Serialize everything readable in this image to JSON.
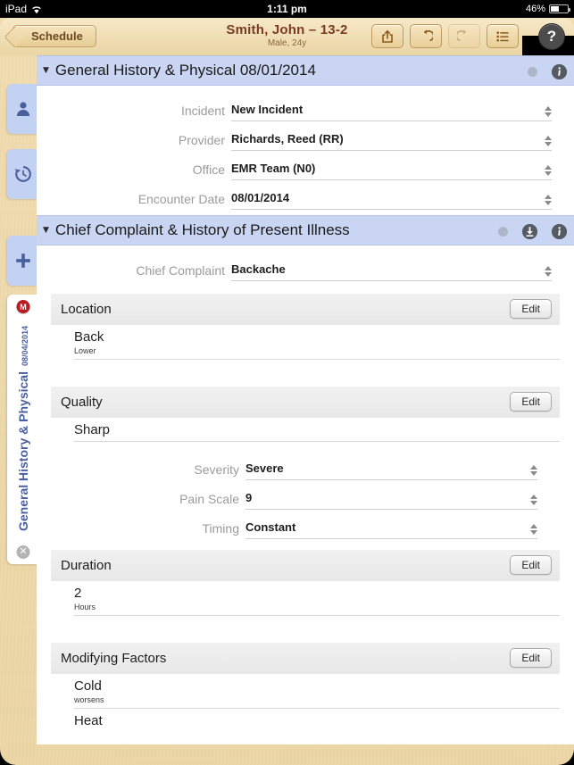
{
  "status_bar": {
    "device": "iPad",
    "wifi_icon": "wifi-icon",
    "time": "1:11 pm",
    "battery_percent": "46%",
    "battery_icon": "battery-icon"
  },
  "navbar": {
    "back_label": "Schedule",
    "patient_name": "Smith, John – 13-2",
    "patient_info": "Male, 24y",
    "tools": [
      {
        "name": "share-icon",
        "label": "Share",
        "disabled": false
      },
      {
        "name": "undo-icon",
        "label": "Undo",
        "disabled": false
      },
      {
        "name": "redo-icon",
        "label": "Redo",
        "disabled": true
      },
      {
        "name": "list-icon",
        "label": "List",
        "disabled": false
      }
    ],
    "help_label": "?"
  },
  "rail": {
    "tabs": [
      {
        "name": "patient-icon",
        "label": "Patient"
      },
      {
        "name": "history-clock-icon",
        "label": "History"
      },
      {
        "name": "add-plus-icon",
        "label": "Add"
      }
    ],
    "document_tab": {
      "badge": "M",
      "title": "General History & Physical",
      "date": "08/04/2014",
      "close_label": "✕"
    }
  },
  "sections": [
    {
      "caret": "▼",
      "title": "General History & Physical 08/01/2014",
      "has_download": false,
      "has_info": true,
      "fields": [
        {
          "label": "Incident",
          "value": "New Incident"
        },
        {
          "label": "Provider",
          "value": "Richards, Reed (RR)"
        },
        {
          "label": "Office",
          "value": "EMR Team (N0)"
        },
        {
          "label": "Encounter Date",
          "value": "08/01/2014"
        }
      ]
    },
    {
      "caret": "▼",
      "title": "Chief Complaint & History of Present Illness",
      "has_download": true,
      "has_info": true,
      "fields": [
        {
          "label": "Chief Complaint",
          "value": "Backache"
        }
      ],
      "subsections": [
        {
          "title": "Location",
          "edit_label": "Edit",
          "entries": [
            {
              "main": "Back",
              "sub": "Lower"
            }
          ],
          "fields": []
        },
        {
          "title": "Quality",
          "edit_label": "Edit",
          "entries": [
            {
              "main": "Sharp",
              "sub": ""
            }
          ],
          "fields": [
            {
              "label": "Severity",
              "value": "Severe"
            },
            {
              "label": "Pain Scale",
              "value": "9"
            },
            {
              "label": "Timing",
              "value": "Constant"
            }
          ]
        },
        {
          "title": "Duration",
          "edit_label": "Edit",
          "entries": [
            {
              "main": "2",
              "sub": "Hours"
            }
          ],
          "fields": []
        },
        {
          "title": "Modifying Factors",
          "edit_label": "Edit",
          "entries": [
            {
              "main": "Cold",
              "sub": "worsens"
            },
            {
              "main": "Heat",
              "sub": ""
            }
          ],
          "fields": []
        }
      ]
    }
  ],
  "colors": {
    "section_header": "#c9d5f2",
    "app_background": "#ecd6a6",
    "rail_tab": "#c3d2f2",
    "badge_red": "#bb1b22",
    "title_brown": "#7a3c20"
  }
}
